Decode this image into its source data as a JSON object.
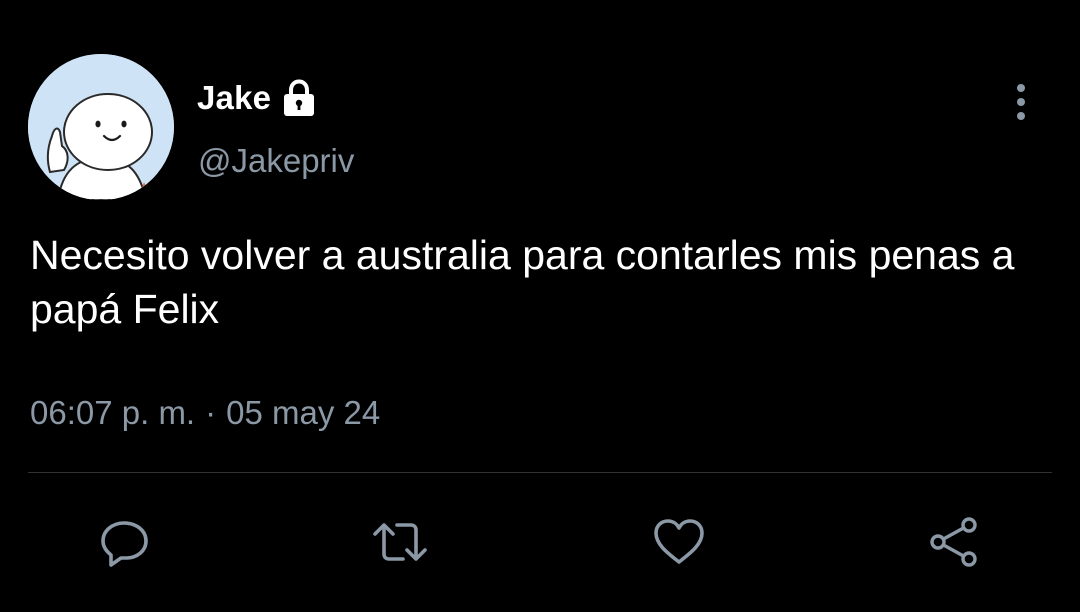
{
  "author": {
    "display_name": "Jake",
    "handle": "@Jakepriv",
    "protected_icon": "lock-icon",
    "avatar_icon": "cartoon-avatar"
  },
  "tweet": {
    "text": "Necesito volver a australia para contarles mis penas a papá Felix",
    "time": "06:07 p. m.",
    "separator": "·",
    "date": "05 may 24"
  },
  "actions": [
    {
      "name": "reply",
      "icon": "comment-icon"
    },
    {
      "name": "retweet",
      "icon": "retweet-icon"
    },
    {
      "name": "like",
      "icon": "heart-icon"
    },
    {
      "name": "share",
      "icon": "share-icon"
    }
  ],
  "menu": {
    "icon": "more-vertical-icon"
  },
  "colors": {
    "background": "#000000",
    "text": "#ffffff",
    "secondary_text": "#8b98a5",
    "divider": "#2f3336",
    "avatar_bg": "#cfe3f6"
  }
}
